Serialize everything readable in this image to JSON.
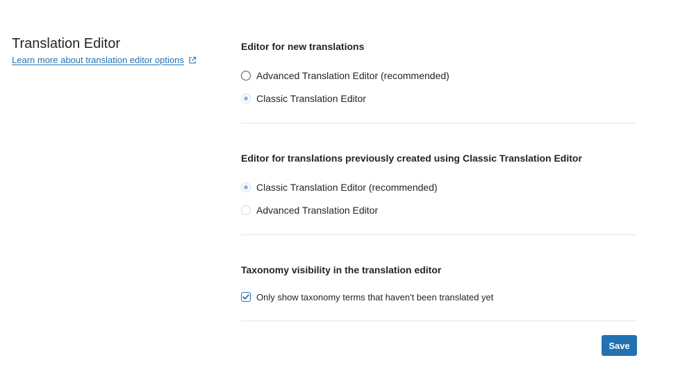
{
  "sidebar": {
    "title": "Translation Editor",
    "learn_more_link": "Learn more about translation editor options",
    "learn_more_icon": "external-link-icon"
  },
  "new_translations": {
    "heading": "Editor for new translations",
    "options": [
      {
        "label": "Advanced Translation Editor (recommended)",
        "selected": false
      },
      {
        "label": "Classic Translation Editor",
        "selected": true
      }
    ]
  },
  "previous_translations": {
    "heading": "Editor for translations previously created using Classic Translation Editor",
    "options": [
      {
        "label": "Classic Translation Editor (recommended)",
        "selected": true
      },
      {
        "label": "Advanced Translation Editor",
        "selected": false
      }
    ]
  },
  "taxonomy": {
    "heading": "Taxonomy visibility in the translation editor",
    "checkbox_label": "Only show taxonomy terms that haven't been translated yet",
    "checked": true
  },
  "actions": {
    "save_label": "Save"
  },
  "colors": {
    "accent": "#2271b1",
    "radio_selected_dot": "#8fb4e0",
    "divider": "#e2e4e7"
  }
}
